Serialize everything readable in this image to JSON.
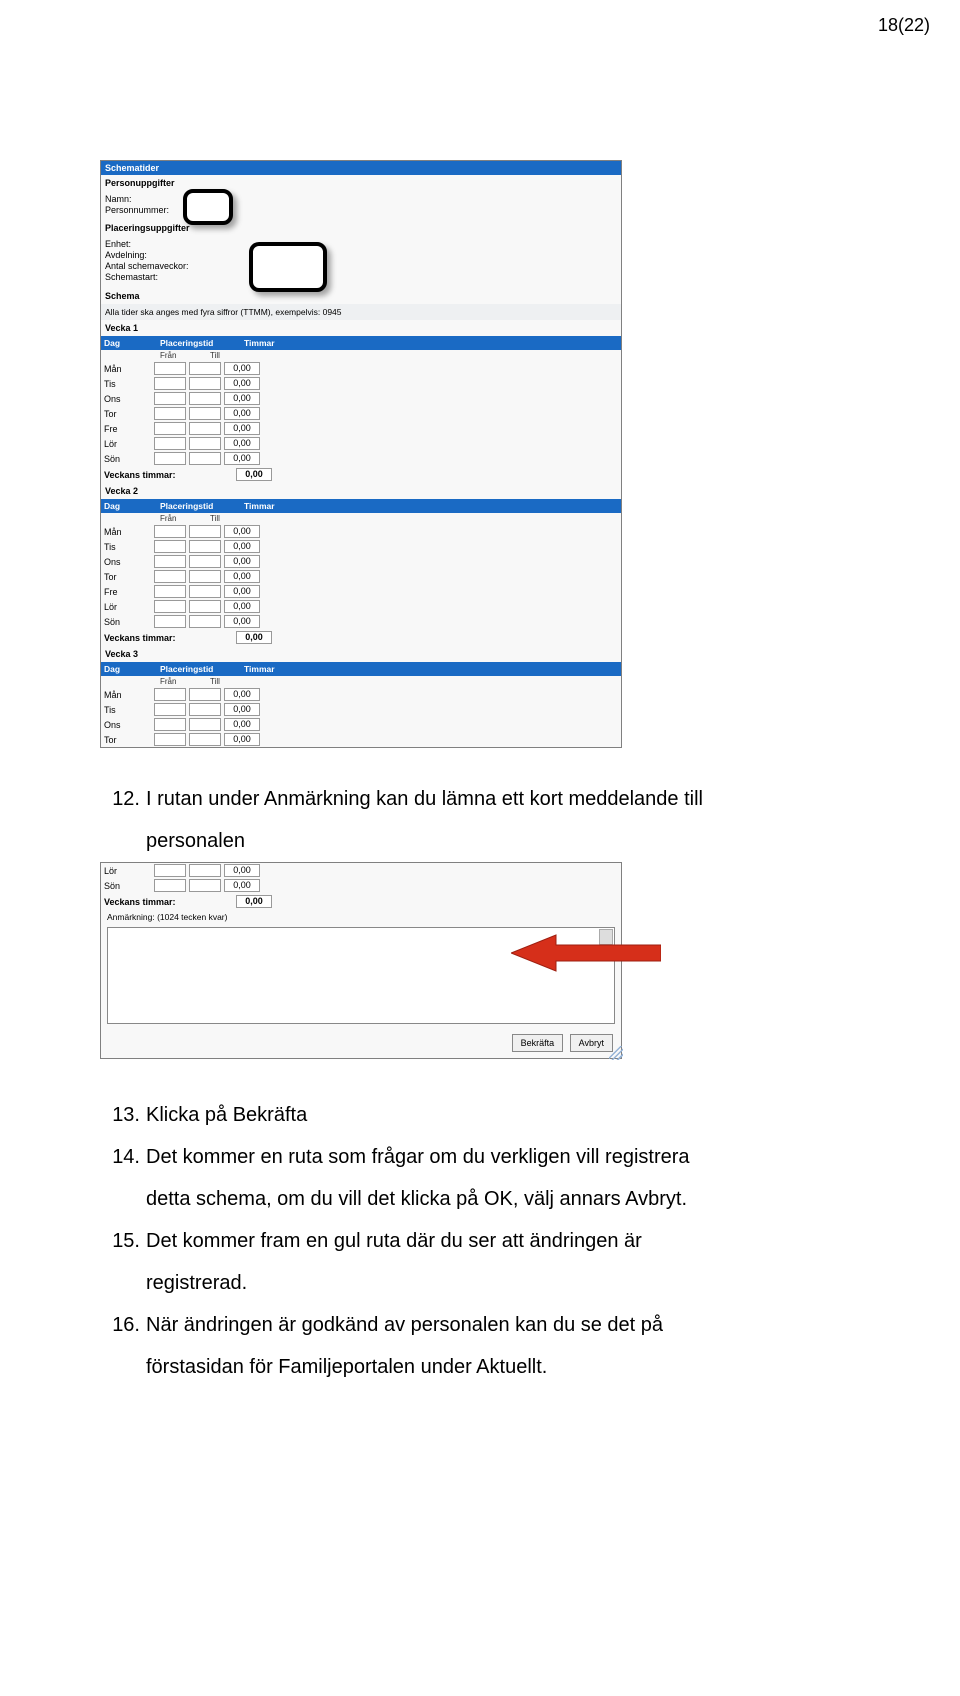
{
  "page_number": "18(22)",
  "form1": {
    "title_bar": "Schematider",
    "section_person": "Personuppgifter",
    "person_labels": {
      "namn": "Namn:",
      "pnr": "Personnummer:"
    },
    "section_place": "Placeringsuppgifter",
    "place_labels": {
      "enhet": "Enhet:",
      "avdelning": "Avdelning:",
      "antal": "Antal schemaveckor:",
      "start": "Schemastart:"
    },
    "section_schema": "Schema",
    "instruction": "Alla tider ska anges med fyra siffror (TTMM), exempelvis: 0945",
    "columns": {
      "dag": "Dag",
      "plac": "Placeringstid",
      "tim": "Timmar",
      "fran": "Från",
      "till": "Till"
    },
    "weeks": [
      {
        "label": "Vecka 1",
        "days": [
          {
            "name": "Mån",
            "tim": "0,00"
          },
          {
            "name": "Tis",
            "tim": "0,00"
          },
          {
            "name": "Ons",
            "tim": "0,00"
          },
          {
            "name": "Tor",
            "tim": "0,00"
          },
          {
            "name": "Fre",
            "tim": "0,00"
          },
          {
            "name": "Lör",
            "tim": "0,00"
          },
          {
            "name": "Sön",
            "tim": "0,00"
          }
        ],
        "sum_label": "Veckans timmar:",
        "sum_value": "0,00"
      },
      {
        "label": "Vecka 2",
        "days": [
          {
            "name": "Mån",
            "tim": "0,00"
          },
          {
            "name": "Tis",
            "tim": "0,00"
          },
          {
            "name": "Ons",
            "tim": "0,00"
          },
          {
            "name": "Tor",
            "tim": "0,00"
          },
          {
            "name": "Fre",
            "tim": "0,00"
          },
          {
            "name": "Lör",
            "tim": "0,00"
          },
          {
            "name": "Sön",
            "tim": "0,00"
          }
        ],
        "sum_label": "Veckans timmar:",
        "sum_value": "0,00"
      },
      {
        "label": "Vecka 3",
        "days": [
          {
            "name": "Mån",
            "tim": "0,00"
          },
          {
            "name": "Tis",
            "tim": "0,00"
          },
          {
            "name": "Ons",
            "tim": "0,00"
          },
          {
            "name": "Tor",
            "tim": "0,00"
          }
        ]
      }
    ]
  },
  "step12": {
    "num": "12.",
    "text": "I rutan under Anmärkning kan du lämna ett kort meddelande till",
    "cont": "personalen"
  },
  "form2": {
    "days": [
      {
        "name": "Lör",
        "tim": "0,00"
      },
      {
        "name": "Sön",
        "tim": "0,00"
      }
    ],
    "sum_label": "Veckans timmar:",
    "sum_value": "0,00",
    "anm_label": "Anmärkning: (1024 tecken kvar)",
    "btn_confirm": "Bekräfta",
    "btn_cancel": "Avbryt"
  },
  "steps_after": [
    {
      "num": "13.",
      "text": "Klicka på Bekräfta"
    },
    {
      "num": "14.",
      "text": "Det kommer en ruta som frågar om du verkligen vill registrera",
      "cont": "detta schema, om du vill det klicka på OK, välj annars Avbryt."
    },
    {
      "num": "15.",
      "text": "Det kommer fram en gul ruta där du ser att ändringen är",
      "cont": "registrerad."
    },
    {
      "num": "16.",
      "text": "När ändringen är godkänd av personalen kan du se det på",
      "cont": "förstasidan för Familjeportalen under Aktuellt."
    }
  ]
}
